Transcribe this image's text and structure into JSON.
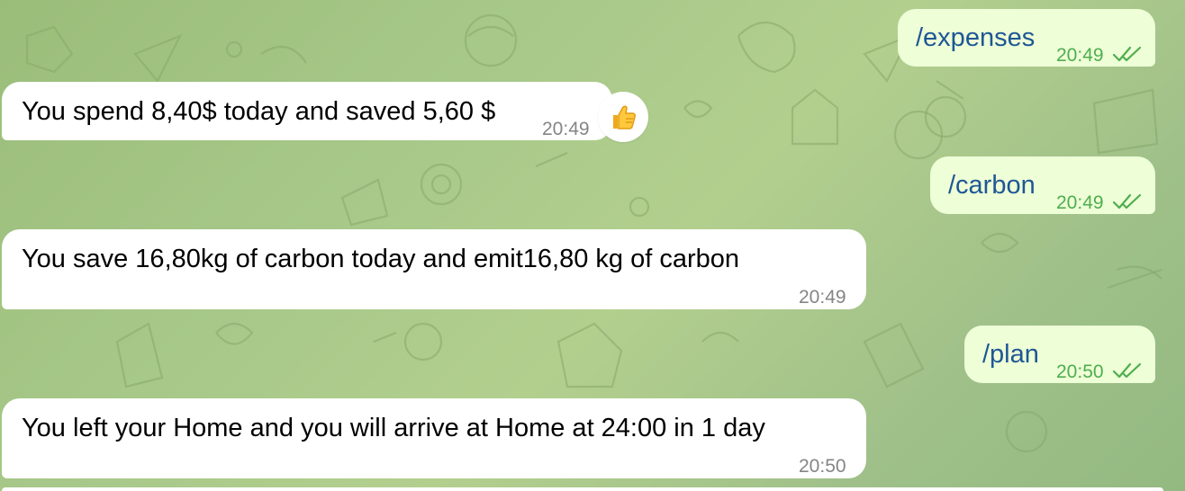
{
  "messages": [
    {
      "direction": "outgoing",
      "text": "/expenses",
      "time": "20:49",
      "status": "read"
    },
    {
      "direction": "incoming",
      "text": "You spend 8,40$ today and saved 5,60 $",
      "time": "20:49",
      "reaction": "thumbs-up-emoji"
    },
    {
      "direction": "outgoing",
      "text": "/carbon",
      "time": "20:49",
      "status": "read"
    },
    {
      "direction": "incoming",
      "text": "You save 16,80kg of carbon today and emit16,80 kg of carbon",
      "time": "20:49"
    },
    {
      "direction": "outgoing",
      "text": "/plan",
      "time": "20:50",
      "status": "read"
    },
    {
      "direction": "incoming",
      "text": "You left your Home and you will arrive at Home at 24:00 in 1 day",
      "time": "20:50"
    }
  ],
  "colors": {
    "incoming_bubble": "#ffffff",
    "outgoing_bubble": "#eefed7",
    "outgoing_text": "#1e5795",
    "read_check": "#4fae4e",
    "timestamp_incoming": "#858585",
    "wallpaper": "#a8c98a"
  }
}
